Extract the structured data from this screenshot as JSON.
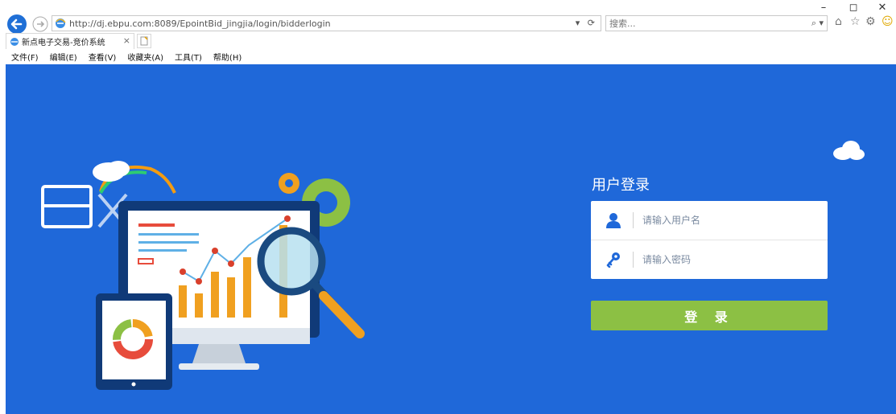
{
  "browser": {
    "url": "http://dj.ebpu.com:8089/EpointBid_jingjia/login/bidderlogin",
    "search_placeholder": "搜索...",
    "tab_title": "新点电子交易-竞价系统",
    "tab_close": "×",
    "url_controls": "▾ ⟳"
  },
  "menu": [
    "文件(F)",
    "编辑(E)",
    "查看(V)",
    "收藏夹(A)",
    "工具(T)",
    "帮助(H)"
  ],
  "window_buttons": [
    "–",
    "◻",
    "✕"
  ],
  "login": {
    "title": "用户登录",
    "username_placeholder": "请输入用户名",
    "password_placeholder": "请输入密码",
    "submit_label": "登 录"
  },
  "colors": {
    "page_bg": "#1f68d9",
    "button_bg": "#8cc044",
    "icon_blue": "#1f68d9"
  }
}
